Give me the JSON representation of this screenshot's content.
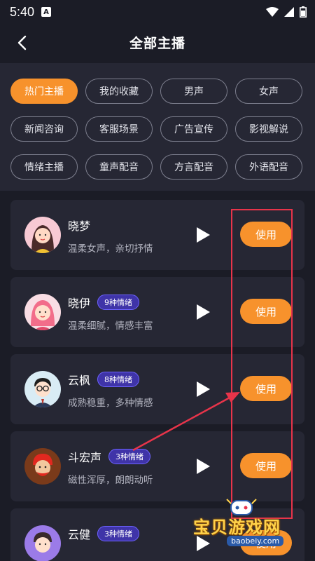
{
  "status": {
    "time": "5:40",
    "notif_glyph": "A"
  },
  "header": {
    "title": "全部主播"
  },
  "filters": [
    {
      "label": "热门主播",
      "active": true
    },
    {
      "label": "我的收藏",
      "active": false
    },
    {
      "label": "男声",
      "active": false
    },
    {
      "label": "女声",
      "active": false
    },
    {
      "label": "新闻咨询",
      "active": false
    },
    {
      "label": "客服场景",
      "active": false
    },
    {
      "label": "广告宣传",
      "active": false
    },
    {
      "label": "影视解说",
      "active": false
    },
    {
      "label": "情绪主播",
      "active": false
    },
    {
      "label": "童声配音",
      "active": false
    },
    {
      "label": "方言配音",
      "active": false
    },
    {
      "label": "外语配音",
      "active": false
    }
  ],
  "anchors": [
    {
      "name": "晓梦",
      "badge": "",
      "desc": "温柔女声，亲切抒情",
      "use_label": "使用",
      "avatar_icon": "female-avatar-icon"
    },
    {
      "name": "晓伊",
      "badge": "9种情绪",
      "desc": "温柔细腻，情感丰富",
      "use_label": "使用",
      "avatar_icon": "female-pink-avatar-icon"
    },
    {
      "name": "云枫",
      "badge": "8种情绪",
      "desc": "成熟稳重，多种情感",
      "use_label": "使用",
      "avatar_icon": "male-glasses-avatar-icon"
    },
    {
      "name": "斗宏声",
      "badge": "3种情绪",
      "desc": "磁性浑厚，朗朗动听",
      "use_label": "使用",
      "avatar_icon": "male-red-hair-avatar-icon"
    },
    {
      "name": "云健",
      "badge": "3种情绪",
      "desc": "",
      "use_label": "使用",
      "avatar_icon": "male-purple-avatar-icon"
    }
  ],
  "watermark": {
    "text": "宝贝游戏网",
    "url": "baobeiy.com"
  },
  "colors": {
    "accent": "#f7922c",
    "background": "#1b1c26",
    "panel": "#262734",
    "badge": "#3f34a8",
    "annotation": "#e8344a"
  }
}
